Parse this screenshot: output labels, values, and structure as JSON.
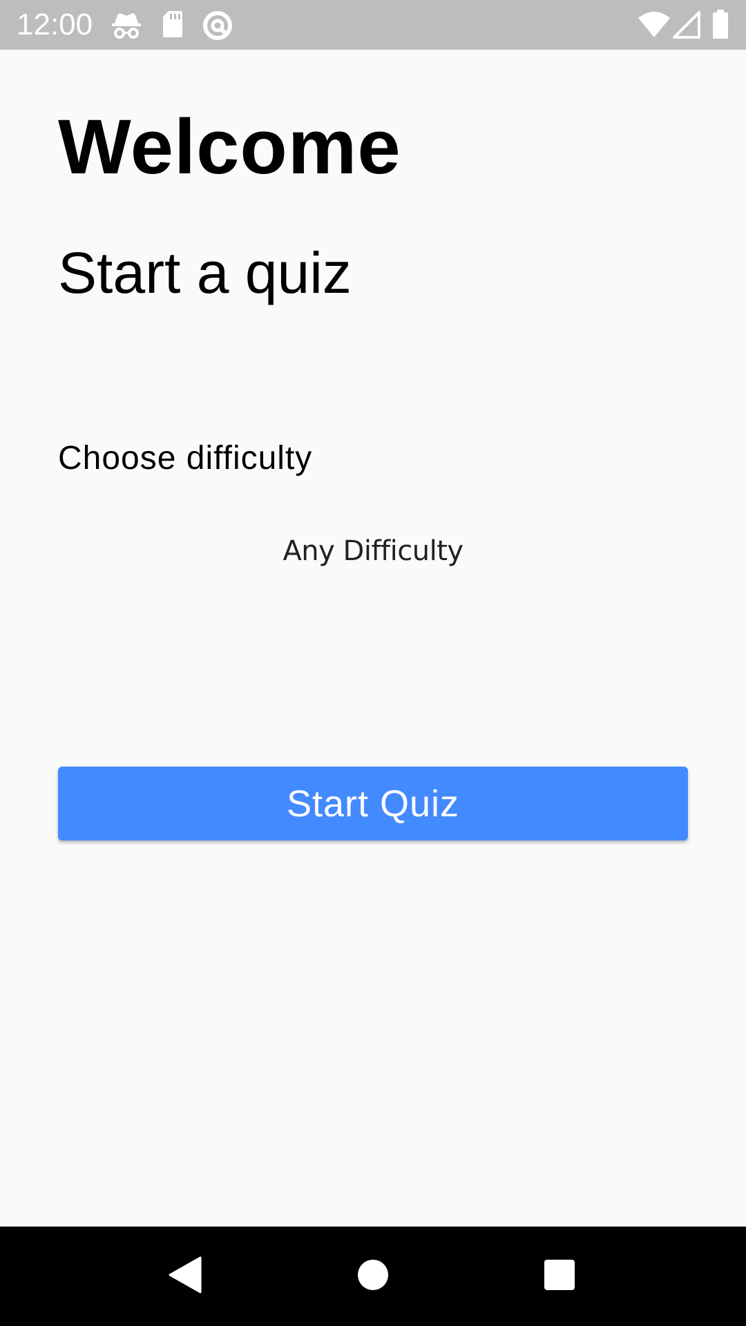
{
  "status_bar": {
    "time": "12:00",
    "icons": [
      "incognito-icon",
      "sd-card-icon",
      "data-saver-icon",
      "wifi-icon",
      "cellular-signal-icon",
      "battery-icon"
    ],
    "background_color": "#bdbdbd"
  },
  "main": {
    "title": "Welcome",
    "subtitle": "Start a quiz",
    "difficulty_label": "Choose difficulty",
    "difficulty_selected": "Any Difficulty",
    "start_button_label": "Start Quiz",
    "accent_color": "#448aff"
  },
  "nav_bar": {
    "items": [
      "back-icon",
      "home-icon",
      "recents-icon"
    ]
  }
}
